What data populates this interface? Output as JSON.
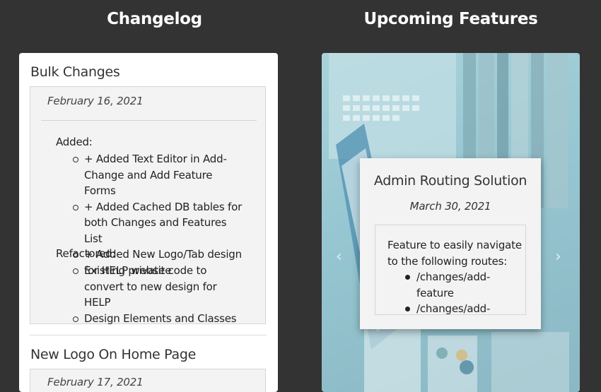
{
  "headings": {
    "changelog": "Changelog",
    "upcoming": "Upcoming Features"
  },
  "changelog": {
    "entries": [
      {
        "title": "Bulk Changes",
        "date": "February 16, 2021",
        "sections": [
          {
            "label": "Added:",
            "items": [
              "+ Added Text Editor in Add-Change and Add Feature Forms",
              "+ Added Cached DB tables for both Changes and Features List",
              "+ Added New Logo/Tab design for HELP website"
            ]
          },
          {
            "label": "Refactored:",
            "items": [
              "Existing private code to convert to new design for HELP",
              "Design Elements and Classes"
            ]
          }
        ]
      },
      {
        "title": "New Logo On Home Page",
        "date": "February 17, 2021"
      }
    ]
  },
  "upcoming": {
    "feature": {
      "title": "Admin Routing Solution",
      "date": "March 30, 2021",
      "description": "Feature to easily navigate to the following routes:",
      "routes": [
        "/changes/add-feature",
        "/changes/add-"
      ]
    },
    "prev_arrow": "‹",
    "next_arrow": "›"
  }
}
